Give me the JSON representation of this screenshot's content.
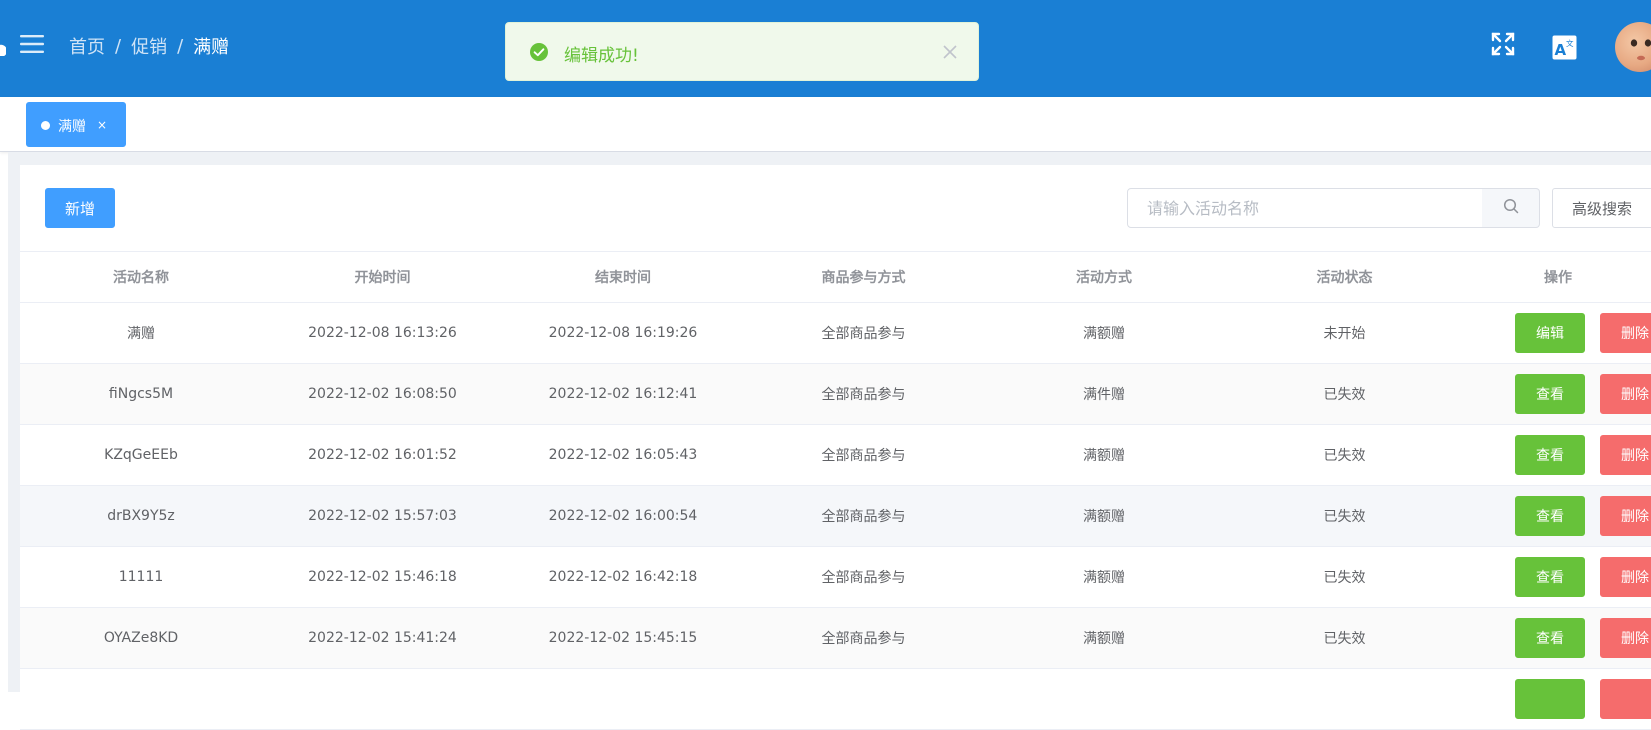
{
  "header": {
    "breadcrumb": {
      "home": "首页",
      "section": "促销",
      "current": "满赠",
      "separator": "/"
    },
    "toast": {
      "message": "编辑成功!",
      "color": "#67c23a"
    },
    "icons": [
      "hamburger-icon",
      "fullscreen-icon",
      "translate-icon",
      "avatar"
    ],
    "colors": {
      "bar": "#1a7fd4"
    }
  },
  "tags": {
    "active_tag": "满赠",
    "close_glyph": "×"
  },
  "toolbar": {
    "add_label": "新增",
    "search_placeholder": "请输入活动名称",
    "advanced_search_label": "高级搜索"
  },
  "table": {
    "columns": [
      "活动名称",
      "开始时间",
      "结束时间",
      "商品参与方式",
      "活动方式",
      "活动状态",
      "操作"
    ],
    "rows": [
      {
        "name": "满赠",
        "start": "2022-12-08 16:13:26",
        "end": "2022-12-08 16:19:26",
        "scope": "全部商品参与",
        "mode": "满额赠",
        "status": "未开始",
        "primary_action": "编辑",
        "delete_action": "删除"
      },
      {
        "name": "fiNgcs5M",
        "start": "2022-12-02 16:08:50",
        "end": "2022-12-02 16:12:41",
        "scope": "全部商品参与",
        "mode": "满件赠",
        "status": "已失效",
        "primary_action": "查看",
        "delete_action": "删除"
      },
      {
        "name": "KZqGeEEb",
        "start": "2022-12-02 16:01:52",
        "end": "2022-12-02 16:05:43",
        "scope": "全部商品参与",
        "mode": "满额赠",
        "status": "已失效",
        "primary_action": "查看",
        "delete_action": "删除"
      },
      {
        "name": "drBX9Y5z",
        "start": "2022-12-02 15:57:03",
        "end": "2022-12-02 16:00:54",
        "scope": "全部商品参与",
        "mode": "满额赠",
        "status": "已失效",
        "primary_action": "查看",
        "delete_action": "删除"
      },
      {
        "name": "11111",
        "start": "2022-12-02 15:46:18",
        "end": "2022-12-02 16:42:18",
        "scope": "全部商品参与",
        "mode": "满额赠",
        "status": "已失效",
        "primary_action": "查看",
        "delete_action": "删除"
      },
      {
        "name": "OYAZe8KD",
        "start": "2022-12-02 15:41:24",
        "end": "2022-12-02 15:45:15",
        "scope": "全部商品参与",
        "mode": "满额赠",
        "status": "已失效",
        "primary_action": "查看",
        "delete_action": "删除"
      },
      {
        "name": "",
        "start": "",
        "end": "",
        "scope": "",
        "mode": "",
        "status": "",
        "primary_action": "",
        "delete_action": ""
      }
    ],
    "colors": {
      "primary_action": "#67c23a",
      "delete_action": "#f56c6c"
    }
  }
}
